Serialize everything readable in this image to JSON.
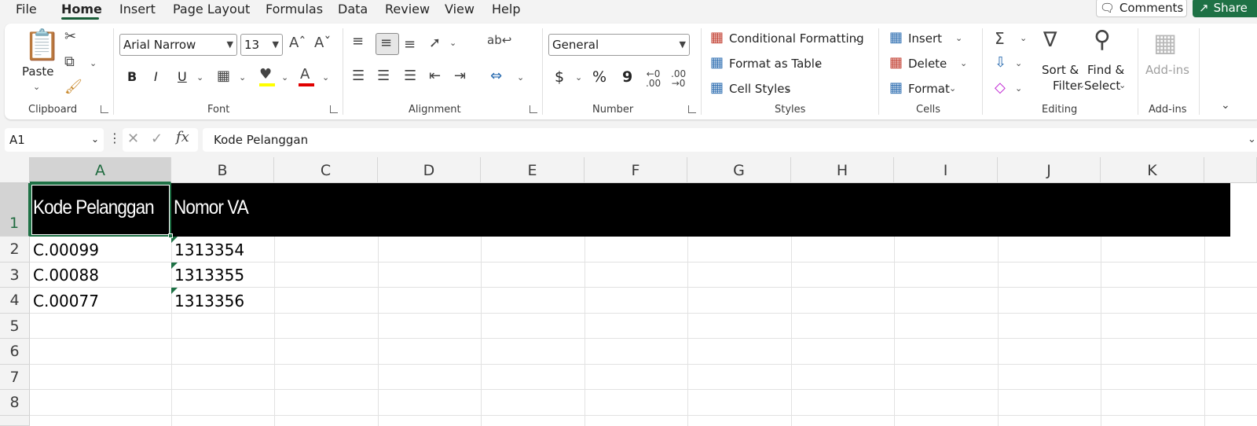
{
  "menu": {
    "tabs": [
      "File",
      "Home",
      "Insert",
      "Page Layout",
      "Formulas",
      "Data",
      "Review",
      "View",
      "Help"
    ],
    "active": "Home",
    "comments_label": "Comments",
    "share_label": "Share"
  },
  "ribbon": {
    "clipboard": {
      "paste_label": "Paste",
      "group_label": "Clipboard"
    },
    "font": {
      "family": "Arial Narrow",
      "size": "13",
      "group_label": "Font",
      "bold": "B",
      "italic": "I",
      "underline": "U"
    },
    "alignment": {
      "group_label": "Alignment"
    },
    "number": {
      "format": "General",
      "group_label": "Number",
      "currency": "$",
      "percent": "%",
      "comma": "9"
    },
    "styles": {
      "conditional_formatting": "Conditional Formatting",
      "format_as_table": "Format as Table",
      "cell_styles": "Cell Styles",
      "group_label": "Styles"
    },
    "cells": {
      "insert": "Insert",
      "delete": "Delete",
      "format": "Format",
      "group_label": "Cells"
    },
    "editing": {
      "sort_filter_line1": "Sort &",
      "sort_filter_line2": "Filter",
      "find_select_line1": "Find &",
      "find_select_line2": "Select",
      "group_label": "Editing"
    },
    "addins": {
      "label": "Add-ins",
      "group_label": "Add-ins"
    }
  },
  "formula_bar": {
    "name_box": "A1",
    "content": "Kode Pelanggan",
    "fx": "fx"
  },
  "sheet": {
    "columns": [
      "A",
      "B",
      "C",
      "D",
      "E",
      "F",
      "G",
      "H",
      "I",
      "J",
      "K"
    ],
    "rows": [
      "1",
      "2",
      "3",
      "4",
      "5",
      "6",
      "7",
      "8"
    ],
    "header": {
      "a1": "Kode Pelanggan",
      "b1": "Nomor VA"
    },
    "data": [
      {
        "kode": "C.00099",
        "nomor": "1313354"
      },
      {
        "kode": "C.00088",
        "nomor": "1313355"
      },
      {
        "kode": "C.00077",
        "nomor": "1313356"
      }
    ]
  },
  "colors": {
    "accent": "#1e7145",
    "header_fill": "#000000",
    "header_text": "#ffffff"
  }
}
